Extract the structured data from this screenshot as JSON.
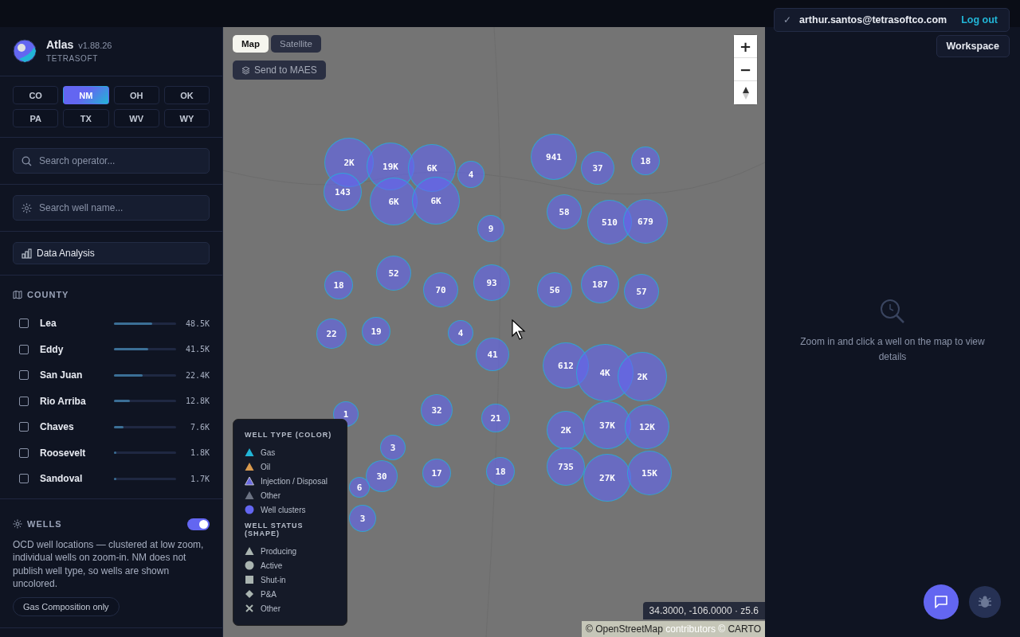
{
  "account": {
    "checkmark": "✓",
    "email": "arthur.santos@tetrasoftco.com",
    "logout": "Log out",
    "workspace": "Workspace"
  },
  "brand": {
    "name": "Atlas",
    "version": "v1.88.26",
    "company": "TETRASOFT"
  },
  "states": [
    {
      "label": "CO",
      "selected": false
    },
    {
      "label": "NM",
      "selected": true
    },
    {
      "label": "OH",
      "selected": false
    },
    {
      "label": "OK",
      "selected": false
    },
    {
      "label": "PA",
      "selected": false
    },
    {
      "label": "TX",
      "selected": false
    },
    {
      "label": "WV",
      "selected": false
    },
    {
      "label": "WY",
      "selected": false
    }
  ],
  "operator_search": {
    "placeholder": "Search operator..."
  },
  "well_search": {
    "placeholder": "Search well name..."
  },
  "data_analysis": "Data Analysis",
  "county": {
    "title": "COUNTY",
    "items": [
      {
        "name": "Lea",
        "count": "48.5K",
        "level": 0.62,
        "checked": false
      },
      {
        "name": "Eddy",
        "count": "41.5K",
        "level": 0.55,
        "checked": false
      },
      {
        "name": "San Juan",
        "count": "22.4K",
        "level": 0.46,
        "checked": false
      },
      {
        "name": "Rio Arriba",
        "count": "12.8K",
        "level": 0.25,
        "checked": false
      },
      {
        "name": "Chaves",
        "count": "7.6K",
        "level": 0.15,
        "checked": false
      },
      {
        "name": "Roosevelt",
        "count": "1.8K",
        "level": 0.04,
        "checked": false
      },
      {
        "name": "Sandoval",
        "count": "1.7K",
        "level": 0.04,
        "checked": false
      }
    ]
  },
  "wells": {
    "title": "WELLS",
    "on": true,
    "description": "OCD well locations — clustered at low zoom, individual wells on zoom-in. NM does not publish well type, so wells are shown uncolored.",
    "filter": "Gas Composition only"
  },
  "map": {
    "tabs": [
      {
        "label": "Map",
        "selected": true
      },
      {
        "label": "Satellite",
        "selected": false
      }
    ],
    "send": "Send to MAES",
    "zoom_in": "+",
    "zoom_out": "−",
    "clusters": [
      "2K",
      "19K",
      "6K",
      "143",
      "6K",
      "6K",
      "4",
      "941",
      "37",
      "18",
      "58",
      "510",
      "679",
      "9",
      "18",
      "52",
      "70",
      "93",
      "56",
      "187",
      "57",
      "22",
      "19",
      "4",
      "41",
      "612",
      "4K",
      "2K",
      "1",
      "32",
      "21",
      "2K",
      "37K",
      "12K",
      "3",
      "735",
      "27K",
      "15K",
      "30",
      "17",
      "18",
      "6",
      "3"
    ],
    "legend": {
      "type_title": "WELL TYPE (COLOR)",
      "types": [
        {
          "label": "Gas",
          "kind": "triangle",
          "color": "#22b5d6"
        },
        {
          "label": "Oil",
          "kind": "triangle",
          "color": "#d99a4e"
        },
        {
          "label": "Injection / Disposal",
          "kind": "triangle",
          "color": "#6a6ae0"
        },
        {
          "label": "Other",
          "kind": "triangle",
          "color": "#6b7282"
        },
        {
          "label": "Well clusters",
          "kind": "circle",
          "color": "#6366f1"
        }
      ],
      "status_title": "WELL STATUS (SHAPE)",
      "statuses": [
        {
          "label": "Producing",
          "kind": "triangle"
        },
        {
          "label": "Active",
          "kind": "circle"
        },
        {
          "label": "Shut-in",
          "kind": "square"
        },
        {
          "label": "P&A",
          "kind": "diamond"
        },
        {
          "label": "Other",
          "kind": "cross"
        }
      ]
    },
    "coordinates": "34.3000, -106.0000 · z5.6",
    "attribution": {
      "prefix": "©",
      "link": "OpenStreetMap",
      "middle": "contributors ©",
      "link2": "CARTO"
    }
  },
  "details": {
    "message": "Zoom in and click a well on the map to view details"
  }
}
